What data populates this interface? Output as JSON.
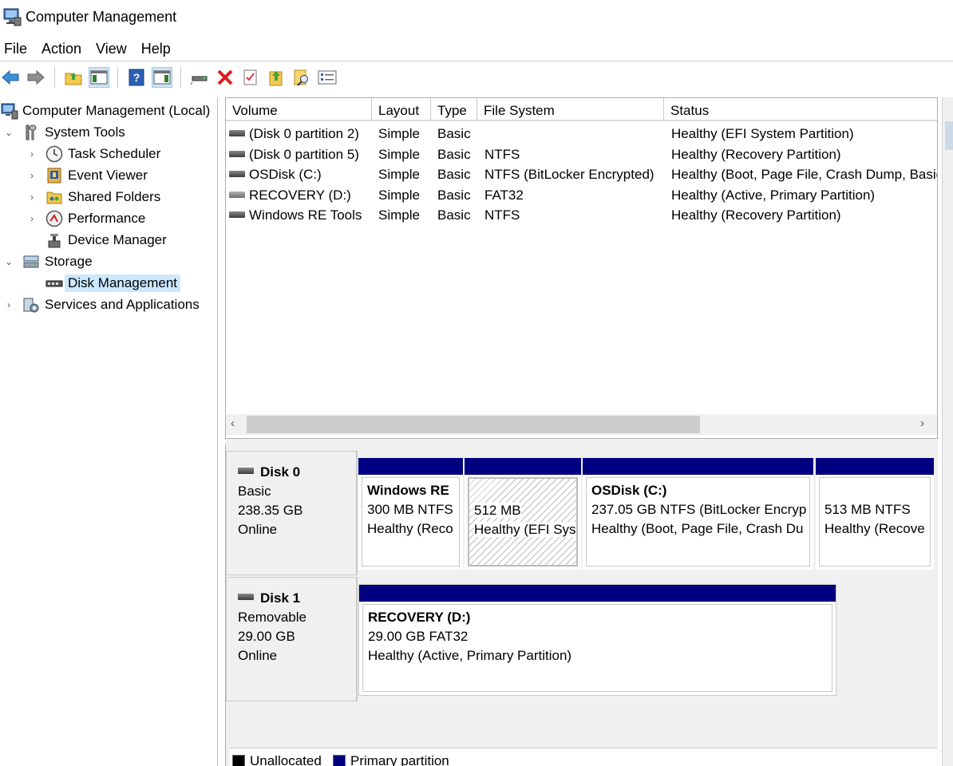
{
  "window": {
    "title": "Computer Management"
  },
  "menu": [
    "File",
    "Action",
    "View",
    "Help"
  ],
  "toolbar": {
    "icons": [
      "back-arrow-icon",
      "forward-arrow-icon",
      "up-folder-icon",
      "show-hide-tree-icon",
      "help-icon",
      "action-pane-icon",
      "connect-icon",
      "delete-icon",
      "properties-icon",
      "open-icon",
      "search-icon",
      "checklist-icon"
    ]
  },
  "tree": {
    "root": "Computer Management (Local)",
    "system_tools": "System Tools",
    "task_scheduler": "Task Scheduler",
    "event_viewer": "Event Viewer",
    "shared_folders": "Shared Folders",
    "performance": "Performance",
    "device_manager": "Device Manager",
    "storage": "Storage",
    "disk_management": "Disk Management",
    "services": "Services and Applications"
  },
  "volume_list": {
    "columns": [
      "Volume",
      "Layout",
      "Type",
      "File System",
      "Status"
    ],
    "rows": [
      [
        "(Disk 0 partition 2)",
        "Simple",
        "Basic",
        "",
        "Healthy (EFI System Partition)"
      ],
      [
        "(Disk 0 partition 5)",
        "Simple",
        "Basic",
        "NTFS",
        "Healthy (Recovery Partition)"
      ],
      [
        "OSDisk (C:)",
        "Simple",
        "Basic",
        "NTFS (BitLocker Encrypted)",
        "Healthy (Boot, Page File, Crash Dump, Basic Data Partition)"
      ],
      [
        "RECOVERY (D:)",
        "Simple",
        "Basic",
        "FAT32",
        "Healthy (Active, Primary Partition)"
      ],
      [
        "Windows RE Tools",
        "Simple",
        "Basic",
        "NTFS",
        "Healthy (Recovery Partition)"
      ]
    ],
    "scroll_left": "‹",
    "scroll_right": "›"
  },
  "disks": [
    {
      "name": "Disk 0",
      "type": "Basic",
      "size": "238.35 GB",
      "status": "Online",
      "partitions": [
        {
          "name": "Windows RE",
          "detail": "300 MB NTFS",
          "health": "Healthy (Reco"
        },
        {
          "name": "",
          "detail": "512 MB",
          "health": "Healthy (EFI Sys"
        },
        {
          "name": "OSDisk  (C:)",
          "detail": "237.05 GB NTFS (BitLocker Encryp",
          "health": "Healthy (Boot, Page File, Crash Du"
        },
        {
          "name": "",
          "detail": "513 MB NTFS",
          "health": "Healthy (Recove"
        }
      ]
    },
    {
      "name": "Disk 1",
      "type": "Removable",
      "size": "29.00 GB",
      "status": "Online",
      "partitions": [
        {
          "name": "RECOVERY  (D:)",
          "detail": "29.00 GB FAT32",
          "health": "Healthy (Active, Primary Partition)"
        }
      ]
    }
  ],
  "legend": [
    {
      "label": "Unallocated",
      "color": "#000000"
    },
    {
      "label": "Primary partition",
      "color": "#000080"
    }
  ]
}
